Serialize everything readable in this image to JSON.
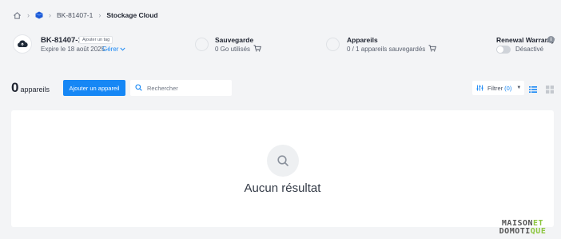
{
  "breadcrumb": {
    "items": [
      "BK-81407-1",
      "Stockage Cloud"
    ]
  },
  "device": {
    "name": "BK-81407-1",
    "tag_button": "Ajouter un tag",
    "expires": "Expire le 18 août 2025",
    "manage_label": "Gérer"
  },
  "stats": {
    "backup": {
      "title": "Sauvegarde",
      "value": "0 Go utilisés"
    },
    "devices": {
      "title": "Appareils",
      "value": "0 / 1 appareils sauvegardés"
    }
  },
  "warranty": {
    "title": "Renewal Warranty",
    "toggle_state": "Désactivé",
    "enabled": false
  },
  "toolbar": {
    "count": "0",
    "count_label": "appareils",
    "add_button": "Ajouter un appareil",
    "search_placeholder": "Rechercher",
    "filter_label": "Filtrer",
    "filter_count": "(0)"
  },
  "empty_state": {
    "message": "Aucun résultat"
  },
  "watermark": {
    "line1_a": "MAISON",
    "line1_b": "ET",
    "line2_a": "DOMOTI",
    "line2_b": "QUE"
  },
  "colors": {
    "accent": "#1687f5",
    "background": "#f3f4f6",
    "panel": "#ffffff",
    "logo_green": "#8dc63f"
  }
}
